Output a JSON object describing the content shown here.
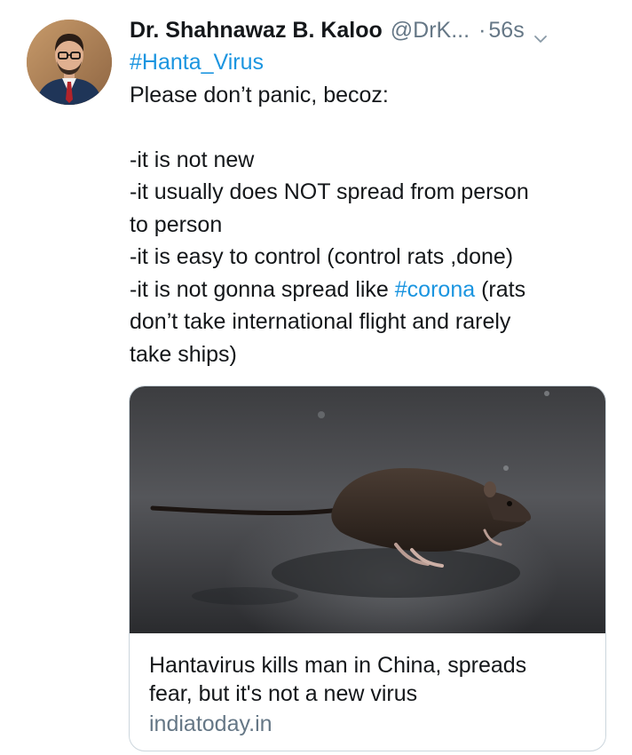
{
  "tweet": {
    "author": {
      "name": "Dr. Shahnawaz B. Kaloo",
      "handle": "@DrK...",
      "separator": "·",
      "time": "56s"
    },
    "lines": {
      "hashtag_line": "#Hanta_Virus",
      "line1": "Please don’t panic, becoz:",
      "line3": "-it is not new",
      "line4": "-it usually does NOT spread from person",
      "line5": "to person",
      "line6": "-it is easy to control (control rats ,done)",
      "line7_pre": "-it is not gonna spread like ",
      "line7_tag": "#corona",
      "line7_post": " (rats",
      "line8": "don’t take international flight and rarely",
      "line9": "take ships)"
    },
    "card": {
      "headline_line1": "Hantavirus kills man in China, spreads",
      "headline_line2": "fear, but it's not a new virus",
      "domain": "indiatoday.in",
      "image_icon": "rat-photo"
    },
    "icons": {
      "avatar": "profile-photo",
      "caret": "chevron-down-icon"
    },
    "colors": {
      "link": "#1b95e0",
      "text": "#14171a",
      "muted": "#657786",
      "card_border": "#ccd6dd"
    }
  }
}
